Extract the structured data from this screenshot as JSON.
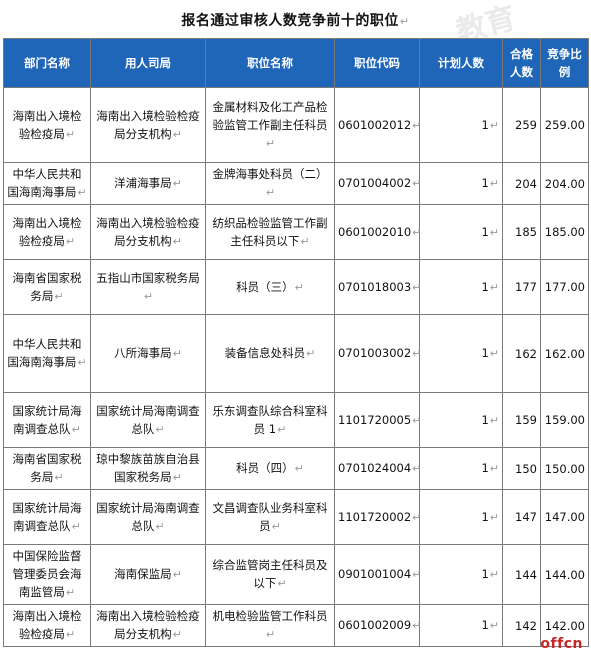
{
  "title": "报名通过审核人数竞争前十的职位",
  "watermark_text": "教育",
  "logo_text": "offcn",
  "colors": {
    "header_bg": "#1f66b8",
    "header_text": "#ffffff",
    "logo": "#c62828"
  },
  "headers": [
    "部门名称",
    "用人司局",
    "职位名称",
    "职位代码",
    "计划人数",
    "合格人数",
    "竞争比例"
  ],
  "rows": [
    {
      "dept": "海南出入境检验检疫局",
      "employer": "海南出入境检验检疫局分支机构",
      "position": "金属材料及化工产品检验监管工作副主任科员",
      "code": "0601002012",
      "plan": "1",
      "passed": "259",
      "ratio": "259.00"
    },
    {
      "dept": "中华人民共和国海南海事局",
      "employer": "洋浦海事局",
      "position": "金牌海事处科员（二）",
      "code": "0701004002",
      "plan": "1",
      "passed": "204",
      "ratio": "204.00"
    },
    {
      "dept": "海南出入境检验检疫局",
      "employer": "海南出入境检验检疫局分支机构",
      "position": "纺织品检验监管工作副主任科员以下",
      "code": "0601002010",
      "plan": "1",
      "passed": "185",
      "ratio": "185.00"
    },
    {
      "dept": "海南省国家税务局",
      "employer": "五指山市国家税务局",
      "position": "科员（三）",
      "code": "0701018003",
      "plan": "1",
      "passed": "177",
      "ratio": "177.00"
    },
    {
      "dept": "中华人民共和国海南海事局",
      "employer": "八所海事局",
      "position": "装备信息处科员",
      "code": "0701003002",
      "plan": "1",
      "passed": "162",
      "ratio": "162.00"
    },
    {
      "dept": "国家统计局海南调查总队",
      "employer": "国家统计局海南调查总队",
      "position": "乐东调查队综合科室科员 1",
      "code": "1101720005",
      "plan": "1",
      "passed": "159",
      "ratio": "159.00"
    },
    {
      "dept": "海南省国家税务局",
      "employer": "琼中黎族苗族自治县国家税务局",
      "position": "科员（四）",
      "code": "0701024004",
      "plan": "1",
      "passed": "150",
      "ratio": "150.00"
    },
    {
      "dept": "国家统计局海南调查总队",
      "employer": "国家统计局海南调查总队",
      "position": "文昌调查队业务科室科员",
      "code": "1101720002",
      "plan": "1",
      "passed": "147",
      "ratio": "147.00"
    },
    {
      "dept": "中国保险监督管理委员会海南监管局",
      "employer": "海南保监局",
      "position": "综合监管岗主任科员及以下",
      "code": "0901001004",
      "plan": "1",
      "passed": "144",
      "ratio": "144.00"
    },
    {
      "dept": "海南出入境检验检疫局",
      "employer": "海南出入境检验检疫局分支机构",
      "position": "机电检验监管工作科员",
      "code": "0601002009",
      "plan": "1",
      "passed": "142",
      "ratio": "142.00"
    }
  ]
}
